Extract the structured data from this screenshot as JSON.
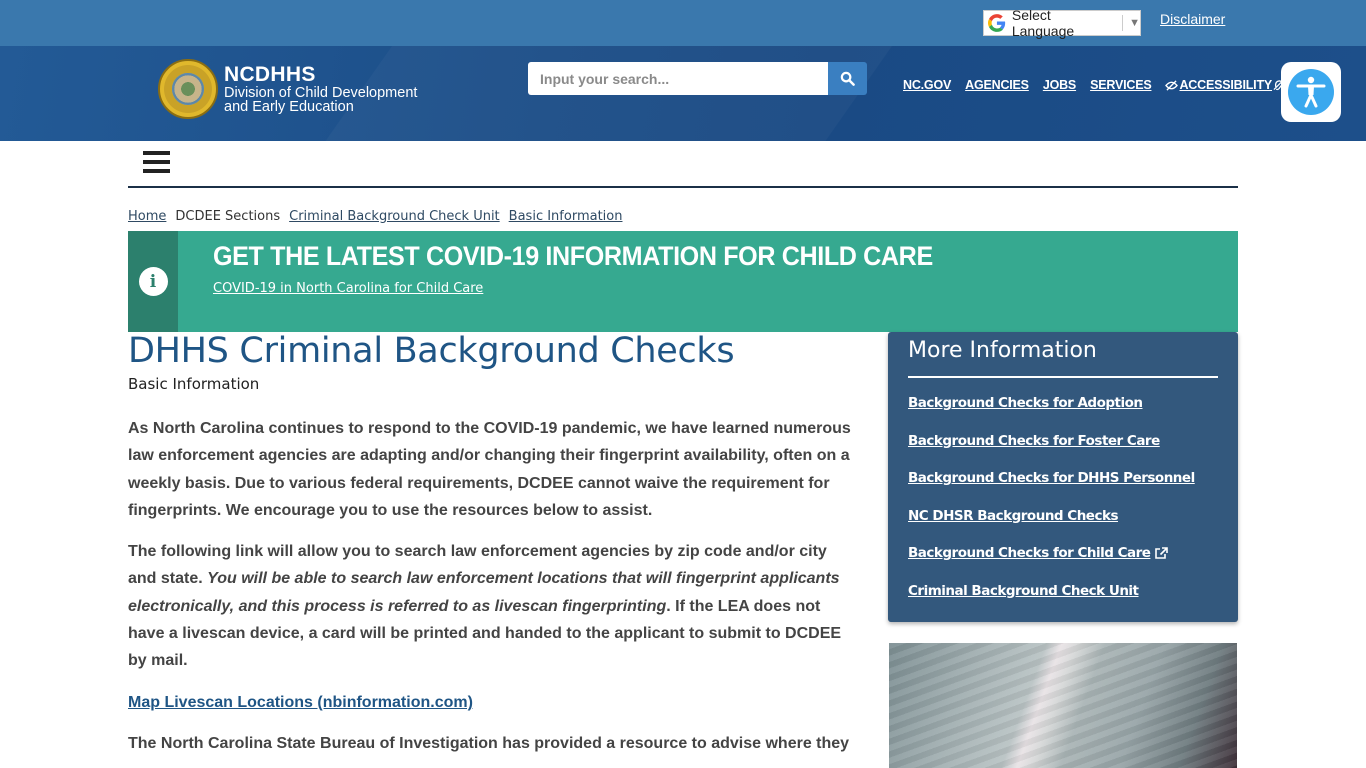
{
  "utility_bar": {
    "language_select": {
      "label": "Select Language",
      "icon": "google-g-icon",
      "arrow": "▼"
    },
    "disclaimer": "Disclaimer"
  },
  "header": {
    "logo": {
      "brand": "NCDHHS",
      "sub_line1": "Division of Child Development",
      "sub_line2": "and Early Education"
    },
    "search": {
      "placeholder": "Input your search...",
      "value": "",
      "button_icon": "search-icon"
    },
    "nav": [
      {
        "label": "NC.GOV"
      },
      {
        "label": "AGENCIES"
      },
      {
        "label": "JOBS"
      },
      {
        "label": "SERVICES"
      },
      {
        "label": "ACCESSIBILITY",
        "icons": [
          "low-vision-icon",
          "hearing-icon"
        ]
      }
    ],
    "accessibility_button": {
      "icon": "accessibility-person-icon"
    }
  },
  "menu": {
    "icon": "hamburger-icon"
  },
  "breadcrumb": [
    {
      "label": "Home",
      "link": true
    },
    {
      "label": "DCDEE Sections",
      "link": false
    },
    {
      "label": "Criminal Background Check Unit",
      "link": true
    },
    {
      "label": "Basic Information",
      "link": true
    }
  ],
  "alert": {
    "icon": "info-icon",
    "title": "GET THE LATEST COVID-19 INFORMATION FOR CHILD CARE",
    "link": "COVID-19 in North Carolina for Child Care",
    "colors": {
      "background": "#36a990",
      "side": "#2c806d"
    }
  },
  "main": {
    "title": "DHHS Criminal Background Checks",
    "subtitle": "Basic Information",
    "paragraph1": "As North Carolina continues to respond to the COVID-19 pandemic, we have learned numerous law enforcement agencies are adapting and/or changing their fingerprint availability, often on a weekly basis.  Due to various federal requirements, DCDEE cannot waive the requirement for fingerprints.  We encourage you to use the resources below to assist.",
    "paragraph2": {
      "before": "The following link will allow you to search law enforcement agencies by zip code and/or city and state. ",
      "italic": "You will be able to search law enforcement locations that will fingerprint applicants electronically, and this process is referred to as livescan fingerprinting",
      "after": ". If the LEA does not have a livescan device, a card will be printed and handed to the applicant to submit to DCDEE by mail."
    },
    "map_link": "Map Livescan Locations (nbinformation.com)",
    "paragraph3": "The North Carolina State Bureau of Investigation has provided a resource to advise where they"
  },
  "sidebar": {
    "title": "More Information",
    "links": [
      {
        "label": "Background Checks for Adoption",
        "external": false
      },
      {
        "label": "Background Checks for Foster Care",
        "external": false
      },
      {
        "label": "Background Checks for DHHS Personnel",
        "external": false
      },
      {
        "label": "NC DHSR Background Checks",
        "external": false
      },
      {
        "label": "Background Checks for Child Care",
        "external": true
      },
      {
        "label": "Criminal Background Check Unit",
        "external": false
      }
    ],
    "image": "gloved-hands-photo"
  },
  "colors": {
    "utility_bar": "#3a78ad",
    "header": "#1c4e88",
    "title_blue": "#1f5585",
    "sidebar": "#33587d",
    "accessibility": "#3aa8ee"
  }
}
